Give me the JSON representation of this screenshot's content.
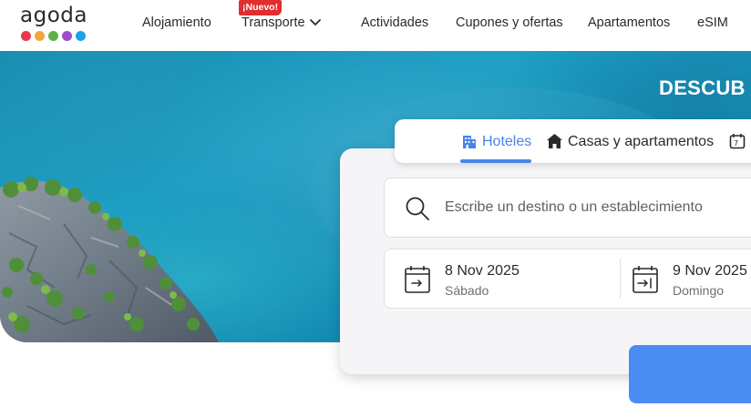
{
  "brand": {
    "logo_text": "agoda",
    "logo_dot_colors": [
      "#e8384c",
      "#f3a43b",
      "#5db24b",
      "#9d4fc7",
      "#1aa3e8"
    ]
  },
  "nav": {
    "items": [
      {
        "label": "Alojamiento"
      },
      {
        "label": "Transporte",
        "badge": "¡Nuevo!",
        "icon": "chevron-down-icon"
      },
      {
        "label": "Actividades"
      },
      {
        "label": "Cupones y ofertas"
      },
      {
        "label": "Apartamentos"
      },
      {
        "label": "eSIM"
      }
    ]
  },
  "hero": {
    "title": "DESCUB"
  },
  "search": {
    "tabs": [
      {
        "label": "Hoteles",
        "icon": "hotel-building-icon",
        "active": true
      },
      {
        "label": "Casas y apartamentos",
        "icon": "house-icon",
        "active": false
      },
      {
        "label": "",
        "icon": "calendar-icon",
        "active": false
      }
    ],
    "destination_placeholder": "Escribe un destino o un establecimiento",
    "destination_value": "",
    "check_in": {
      "date": "8 Nov 2025",
      "weekday": "Sábado"
    },
    "check_out": {
      "date": "9 Nov 2025",
      "weekday": "Domingo"
    },
    "button_label": ""
  },
  "colors": {
    "accent": "#4a84e8",
    "badge": "#e12d2d",
    "search_button": "#4a8cf2",
    "panel_bg": "#f5f5f8"
  }
}
